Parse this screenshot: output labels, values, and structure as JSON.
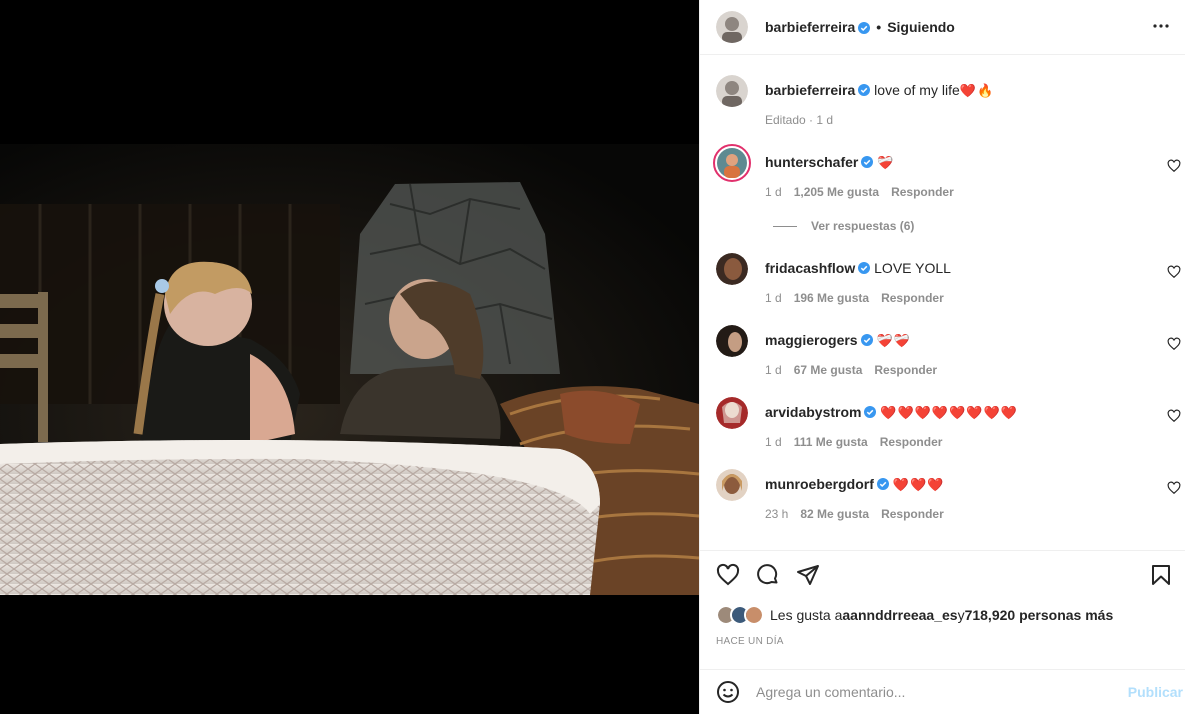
{
  "post": {
    "author": "barbieferreira",
    "follow_state": "Siguiendo",
    "caption_user": "barbieferreira",
    "caption_text": "love of my life",
    "caption_emoji": "❤️🔥",
    "caption_meta": "Editado · 1 d"
  },
  "comments": [
    {
      "user": "hunterschafer",
      "text": "",
      "emoji": "❤️‍🩹",
      "age": "1 d",
      "likes": "1,205 Me gusta",
      "reply": "Responder",
      "view_replies": "Ver respuestas (6)"
    },
    {
      "user": "fridacashflow",
      "text": "LOVE YOLL",
      "emoji": "",
      "age": "1 d",
      "likes": "196 Me gusta",
      "reply": "Responder"
    },
    {
      "user": "maggierogers",
      "text": "",
      "emoji": "❤️‍🩹❤️‍🩹",
      "age": "1 d",
      "likes": "67 Me gusta",
      "reply": "Responder"
    },
    {
      "user": "arvidabystrom",
      "text": "",
      "emoji": "❤️❤️❤️❤️❤️❤️❤️❤️",
      "age": "1 d",
      "likes": "111 Me gusta",
      "reply": "Responder"
    },
    {
      "user": "munroebergdorf",
      "text": "",
      "emoji": "❤️❤️❤️",
      "age": "23 h",
      "likes": "82 Me gusta",
      "reply": "Responder"
    }
  ],
  "likes_line": {
    "prefix": "Les gusta a ",
    "user": "aannddrreeaa_es",
    "middle": " y ",
    "count": "718,920 personas más"
  },
  "post_time": "HACE UN DÍA",
  "composer": {
    "placeholder": "Agrega un comentario...",
    "publish": "Publicar"
  },
  "colors": {
    "accent": "#0095f6",
    "publish_disabled": "#b2dffc",
    "secondary_text": "#8e8e8e",
    "heart_red": "#ed1c24"
  },
  "icons": [
    "more-icon",
    "verified-badge-icon",
    "heart-icon",
    "comment-icon",
    "share-icon",
    "bookmark-icon",
    "emoji-icon"
  ]
}
